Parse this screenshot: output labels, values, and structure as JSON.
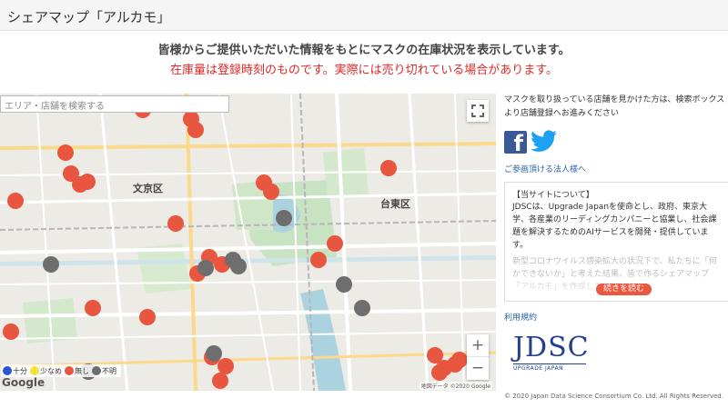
{
  "header": {
    "title": "シェアマップ「アルカモ」"
  },
  "intro": {
    "line1": "皆様からご提供いただいた情報をもとにマスクの在庫状況を表示しています。",
    "line2": "在庫量は登録時刻のものです。実際には売り切れている場合があります。"
  },
  "map": {
    "search_placeholder": "エリア・店舗を検索する",
    "fullscreen_icon": "fullscreen-icon",
    "zoom_in": "+",
    "zoom_out": "−",
    "google_label": "Google",
    "copyright": "地図データ ©2020 Google",
    "area_labels": [
      "文京区",
      "台東区"
    ],
    "legend": [
      {
        "label": "十分",
        "color": "#2c55d6"
      },
      {
        "label": "少なめ",
        "color": "#f2e23a"
      },
      {
        "label": "無し",
        "color": "#e8563f"
      },
      {
        "label": "不明",
        "color": "#6e6e6e"
      }
    ]
  },
  "sidebar": {
    "report_text": "マスクを取り扱っている店舗を見かけた方は、検索ボックスより店舗登録へお進みください",
    "corp_link": "ご参画頂ける法人様へ",
    "about": {
      "heading": "【当サイトについて】",
      "paragraph1": "JDSCは、Upgrade Japanを使命とし、政府、東京大学、各産業のリーディングカンパニーと協業し、社会課題を解決するためのAIサービスを開発・提供しています。",
      "paragraph2": "新型コロナウイルス感染拡大の状況下で、私たちに「何かできないか」と考えた結果、皆で作るシェアマップ「アルカモ」を作成しました。",
      "read_more": "続きを読む"
    },
    "terms_link": "利用規約",
    "logo_text": "JDSC",
    "logo_sub": "UPGRADE JAPAN"
  },
  "footer": {
    "copyright": "© 2020 Japan Data Science Consortium Co. Ltd. All Rights Reserved."
  },
  "colors": {
    "none": "#e8563f",
    "unknown": "#6e6e6e",
    "link": "#2b62a8",
    "warning": "#e02828",
    "brand": "#1f3f8f"
  }
}
